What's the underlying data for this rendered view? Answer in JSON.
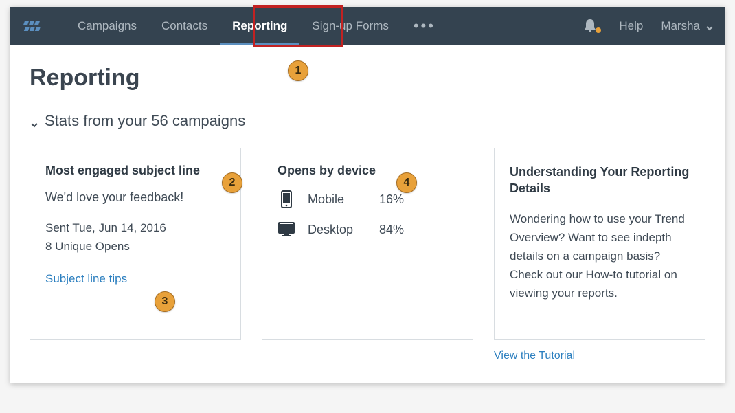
{
  "nav": {
    "items": [
      "Campaigns",
      "Contacts",
      "Reporting",
      "Sign-up Forms"
    ],
    "active_index": 2,
    "help": "Help",
    "user": "Marsha"
  },
  "page_title": "Reporting",
  "stats_header": "Stats from your 56 campaigns",
  "cards": {
    "engaged": {
      "title": "Most engaged subject line",
      "subject": "We'd love your feedback!",
      "sent": "Sent Tue, Jun 14, 2016",
      "opens": "8 Unique Opens",
      "tips_link": "Subject line tips"
    },
    "opens": {
      "title": "Opens by device",
      "rows": [
        {
          "name": "Mobile",
          "pct": "16%"
        },
        {
          "name": "Desktop",
          "pct": "84%"
        }
      ]
    },
    "understand": {
      "title": "Understanding Your Reporting Details",
      "body": "Wondering how to use your Trend Overview? Want to see indepth details on a campaign basis? Check out our How-to tutorial on viewing your reports.",
      "link": "View the Tutorial"
    }
  },
  "annotations": [
    "1",
    "2",
    "3",
    "4"
  ]
}
